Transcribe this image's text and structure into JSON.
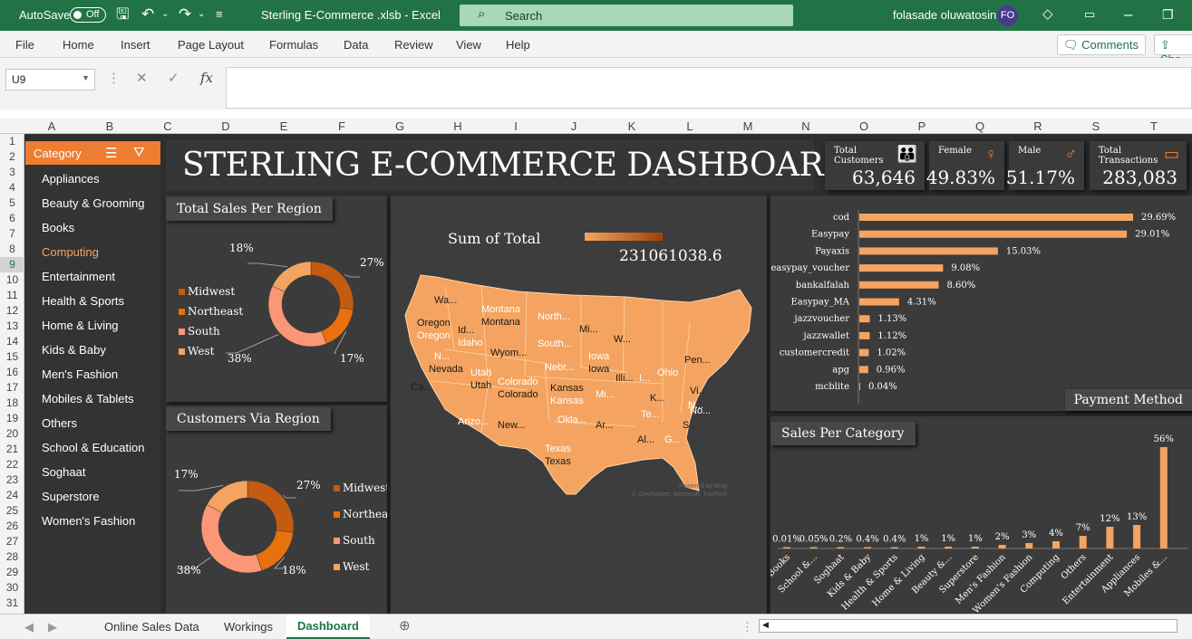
{
  "titlebar": {
    "autosave_label": "AutoSave",
    "autosave_state": "Off",
    "file_title": "Sterling E-Commerce .xlsb - Excel",
    "search_placeholder": "Search",
    "user_name": "folasade oluwatosin",
    "user_initials": "FO"
  },
  "ribbon": {
    "menus": [
      "File",
      "Home",
      "Insert",
      "Page Layout",
      "Formulas",
      "Data",
      "Review",
      "View",
      "Help"
    ],
    "comments_label": "Comments",
    "share_label": "Sha"
  },
  "formula_bar": {
    "name_box": "U9",
    "fx_label": "fx",
    "formula": ""
  },
  "columns": [
    "A",
    "B",
    "C",
    "D",
    "E",
    "F",
    "G",
    "H",
    "I",
    "J",
    "K",
    "L",
    "M",
    "N",
    "O",
    "P",
    "Q",
    "R",
    "S",
    "T"
  ],
  "rows": [
    "1",
    "2",
    "3",
    "4",
    "5",
    "6",
    "7",
    "8",
    "9",
    "10",
    "11",
    "12",
    "13",
    "14",
    "15",
    "16",
    "17",
    "18",
    "19",
    "20",
    "21",
    "22",
    "23",
    "24",
    "25",
    "26",
    "27",
    "28",
    "29",
    "30",
    "31"
  ],
  "selected_row": "9",
  "slicer": {
    "header": "Category",
    "items": [
      "Appliances",
      "Beauty & Grooming",
      "Books",
      "Computing",
      "Entertainment",
      "Health & Sports",
      "Home & Living",
      "Kids & Baby",
      "Men's Fashion",
      "Mobiles & Tablets",
      "Others",
      "School & Education",
      "Soghaat",
      "Superstore",
      "Women's Fashion"
    ],
    "selected": "Computing"
  },
  "dashboard": {
    "title": "STERLING E-COMMERCE DASHBOARD",
    "kpis": {
      "customers_label_1": "Total",
      "customers_label_2": "Customers",
      "customers_value": "63,646",
      "female_label": "Female",
      "female_value": "49.83%",
      "male_label": "Male",
      "male_value": "51.17%",
      "transactions_label_1": "Total",
      "transactions_label_2": "Transactions",
      "transactions_value": "283,083"
    },
    "sales_region_title": "Total Sales Per Region",
    "customers_region_title": "Customers Via Region",
    "map_title": "Sum of Total",
    "map_value": "231061038.6",
    "map_credit_1": "Powered by Bing",
    "map_credit_2": "© GeoNames, Microsoft, TomTom",
    "map_states": [
      "Wa...",
      "Montana",
      "Montana",
      "North...",
      "Oregon",
      "Oregon",
      "Id...",
      "Idaho",
      "Mi...",
      "South...",
      "Wyom...",
      "Iowa",
      "Iowa",
      "N...",
      "Nevada",
      "Utah",
      "Utah",
      "Colorado",
      "Colorado",
      "Nebr...",
      "Kansas",
      "Kansas",
      "Ca...",
      "Ohio",
      "Pen...",
      "Arizo...",
      "New...",
      "Okla...",
      "Ar...",
      "Texas",
      "Texas",
      "Te...",
      "Al...",
      "G...",
      "S...",
      "N...",
      "Illi...",
      "I...",
      "K...",
      "Mi...",
      "Vi...",
      "No...",
      "W..."
    ],
    "payment_title": "Payment Method",
    "category_title": "Sales Per Category",
    "colors": {
      "midwest": "#c55a11",
      "northeast": "#e8700d",
      "south": "#fb9677",
      "west": "#f4a460",
      "bar": "#f4a460",
      "accent": "#ed7d31"
    }
  },
  "chart_data": [
    {
      "type": "pie",
      "title": "Total Sales Per Region",
      "categories": [
        "Midwest",
        "Northeast",
        "South",
        "West"
      ],
      "values": [
        27,
        17,
        38,
        18
      ],
      "labels": [
        "27%",
        "17%",
        "38%",
        "18%"
      ]
    },
    {
      "type": "pie",
      "title": "Customers Via Region",
      "categories": [
        "Midwest",
        "Northeast",
        "South",
        "West"
      ],
      "values": [
        27,
        18,
        38,
        17
      ],
      "labels": [
        "27%",
        "18%",
        "38%",
        "17%"
      ]
    },
    {
      "type": "bar",
      "orientation": "horizontal",
      "title": "Payment Method",
      "categories": [
        "cod",
        "Easypay",
        "Payaxis",
        "easypay_voucher",
        "bankalfalah",
        "Easypay_MA",
        "jazzvoucher",
        "jazzwallet",
        "customercredit",
        "apg",
        "mcblite"
      ],
      "values": [
        29.69,
        29.01,
        15.03,
        9.08,
        8.6,
        4.31,
        1.13,
        1.12,
        1.02,
        0.96,
        0.04
      ],
      "labels": [
        "29.69%",
        "29.01%",
        "15.03%",
        "9.08%",
        "8.60%",
        "4.31%",
        "1.13%",
        "1.12%",
        "1.02%",
        "0.96%",
        "0.04%"
      ]
    },
    {
      "type": "bar",
      "title": "Sales Per Category",
      "categories": [
        "Books",
        "School &...",
        "Soghaat",
        "Kids & Baby",
        "Health & Sports",
        "Home & Living",
        "Beauty &...",
        "Superstore",
        "Men's Fashion",
        "Women's Fashion",
        "Computing",
        "Others",
        "Entertainment",
        "Appliances",
        "Mobiles &..."
      ],
      "values": [
        0.01,
        0.05,
        0.2,
        0.4,
        0.4,
        1,
        1,
        1,
        2,
        3,
        4,
        7,
        12,
        13,
        56
      ],
      "labels": [
        "0.01%",
        "0.05%",
        "0.2%",
        "0.4%",
        "0.4%",
        "1%",
        "1%",
        "1%",
        "2%",
        "3%",
        "4%",
        "7%",
        "12%",
        "13%",
        "56%"
      ]
    }
  ],
  "sheet_tabs": [
    "Online Sales Data",
    "Workings",
    "Dashboard"
  ],
  "active_tab": "Dashboard"
}
